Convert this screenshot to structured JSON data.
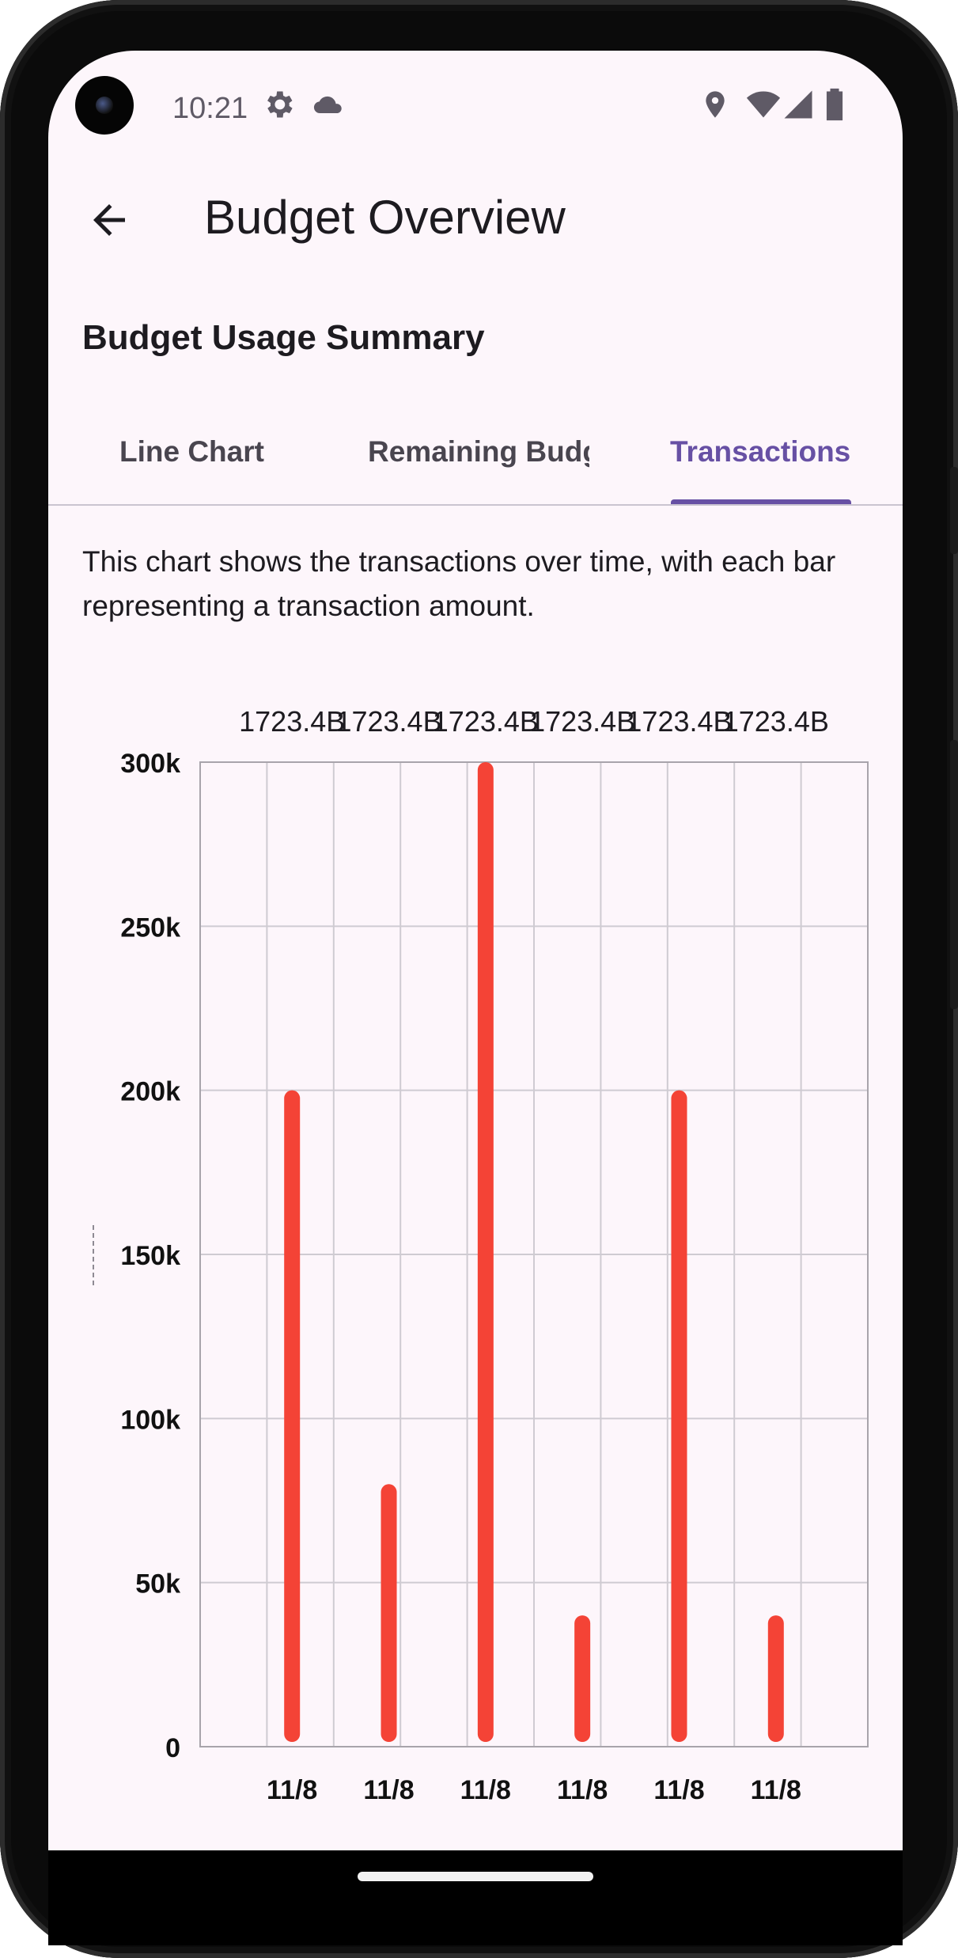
{
  "status_bar": {
    "time": "10:21",
    "left_icons": [
      "settings-gear-icon",
      "cloud-icon"
    ],
    "right_icons": [
      "location-pin-icon",
      "wifi-icon",
      "signal-icon",
      "battery-icon"
    ]
  },
  "app_bar": {
    "back_icon": "back-arrow-icon",
    "title": "Budget Overview"
  },
  "section_title": "Budget Usage Summary",
  "tabs": [
    {
      "label": "Line Chart",
      "selected": false
    },
    {
      "label": "Remaining Budget",
      "selected": false
    },
    {
      "label": "Transactions",
      "selected": true
    }
  ],
  "description": "This chart shows the transactions over time, with each bar representing a transaction amount.",
  "colors": {
    "accent": "#6750a4",
    "bar": "#f44336",
    "background": "#fdf6fb",
    "grid": "#cfcbd2"
  },
  "chart_data": {
    "type": "bar",
    "title": "",
    "xlabel": "",
    "ylabel": "",
    "categories": [
      "11/8",
      "11/8",
      "11/8",
      "11/8",
      "11/8",
      "11/8"
    ],
    "values": [
      200000,
      80000,
      300000,
      40000,
      200000,
      40000
    ],
    "top_labels": [
      "1723.4B",
      "1723.4B",
      "1723.4B",
      "1723.4B",
      "1723.4B",
      "1723.4B"
    ],
    "ylim": [
      0,
      300000
    ],
    "yticks": [
      0,
      50000,
      100000,
      150000,
      200000,
      250000,
      300000
    ],
    "ytick_labels": [
      "0",
      "50k",
      "100k",
      "150k",
      "200k",
      "250k",
      "300k"
    ],
    "grid": true,
    "legend": "none"
  }
}
